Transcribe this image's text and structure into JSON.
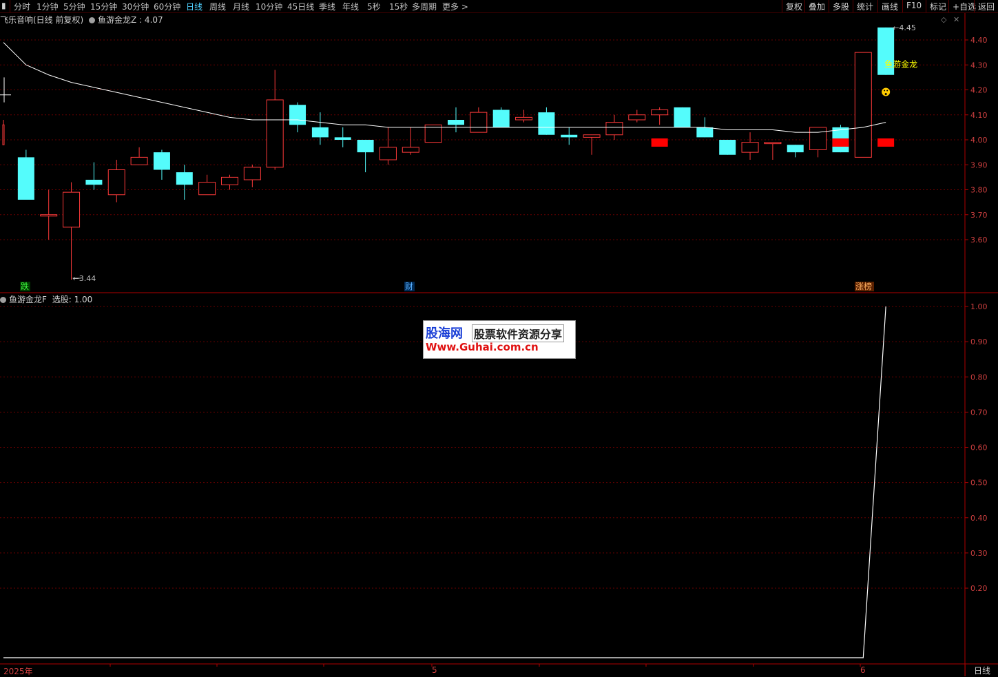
{
  "toolbar": {
    "periods": [
      "分时",
      "1分钟",
      "5分钟",
      "15分钟",
      "30分钟",
      "60分钟",
      "日线",
      "周线",
      "月线",
      "10分钟",
      "45日线",
      "季线",
      "年线",
      "5秒",
      "15秒",
      "多周期",
      "更多 >"
    ],
    "active_period": "日线",
    "right_buttons": [
      "复权",
      "叠加",
      "多股",
      "统计",
      "画线",
      "F10",
      "标记",
      "+自选",
      "返回"
    ]
  },
  "main_panel": {
    "stock_title": "飞乐音响(日线 前复权)",
    "indicator_name": "鱼游金龙Z",
    "indicator_value": ": 4.07",
    "y_ticks": [
      "4.40",
      "4.30",
      "4.20",
      "4.10",
      "4.00",
      "3.90",
      "3.80",
      "3.70",
      "3.60"
    ],
    "low_annotation": "3.44",
    "high_annotation": "4.45",
    "signal_text": "鱼游金龙",
    "event_labels": [
      "跌",
      "财",
      "涨榜"
    ]
  },
  "sub_panel": {
    "indicator_name": "鱼游金龙F",
    "indicator_value": "选股: 1.00",
    "y_ticks": [
      "1.00",
      "0.90",
      "0.80",
      "0.70",
      "0.60",
      "0.50",
      "0.40",
      "0.30",
      "0.20"
    ]
  },
  "x_axis": {
    "labels": [
      "2025年",
      "5",
      "6"
    ],
    "period": "日线"
  },
  "watermark": {
    "line1_brand": "股海网",
    "line1_text": "股票软件资源分享",
    "line2": "Www.Guhai.com.cn"
  },
  "colors": {
    "up": "#ff3a3a",
    "down": "#54fcfc",
    "ma": "#ffffff",
    "signal_bar": "#ff0000",
    "axis": "#b00000",
    "grid": "#6a0000"
  },
  "chart_data": [
    {
      "type": "candlestick",
      "ylim": [
        3.44,
        4.45
      ],
      "candles": [
        {
          "o": 3.98,
          "h": 4.08,
          "l": 4.02,
          "c": 4.06
        },
        {
          "o": 3.93,
          "h": 3.96,
          "l": 3.76,
          "c": 3.76
        },
        {
          "o": 3.7,
          "h": 3.8,
          "l": 3.6,
          "c": 3.7
        },
        {
          "o": 3.65,
          "h": 3.83,
          "l": 3.44,
          "c": 3.79
        },
        {
          "o": 3.84,
          "h": 3.91,
          "l": 3.8,
          "c": 3.82
        },
        {
          "o": 3.78,
          "h": 3.92,
          "l": 3.75,
          "c": 3.88
        },
        {
          "o": 3.9,
          "h": 3.97,
          "l": 3.9,
          "c": 3.93
        },
        {
          "o": 3.95,
          "h": 3.96,
          "l": 3.84,
          "c": 3.88
        },
        {
          "o": 3.87,
          "h": 3.9,
          "l": 3.76,
          "c": 3.82
        },
        {
          "o": 3.78,
          "h": 3.86,
          "l": 3.78,
          "c": 3.83
        },
        {
          "o": 3.82,
          "h": 3.86,
          "l": 3.8,
          "c": 3.85
        },
        {
          "o": 3.84,
          "h": 3.9,
          "l": 3.81,
          "c": 3.89
        },
        {
          "o": 3.89,
          "h": 4.28,
          "l": 3.88,
          "c": 4.16
        },
        {
          "o": 4.14,
          "h": 4.15,
          "l": 4.03,
          "c": 4.06
        },
        {
          "o": 4.05,
          "h": 4.11,
          "l": 3.98,
          "c": 4.01
        },
        {
          "o": 4.01,
          "h": 4.05,
          "l": 3.97,
          "c": 4.0
        },
        {
          "o": 4.0,
          "h": 4.0,
          "l": 3.87,
          "c": 3.95
        },
        {
          "o": 3.92,
          "h": 4.05,
          "l": 3.9,
          "c": 3.97
        },
        {
          "o": 3.95,
          "h": 4.05,
          "l": 3.94,
          "c": 3.97
        },
        {
          "o": 3.99,
          "h": 4.06,
          "l": 3.99,
          "c": 4.06
        },
        {
          "o": 4.08,
          "h": 4.13,
          "l": 4.03,
          "c": 4.06
        },
        {
          "o": 4.03,
          "h": 4.13,
          "l": 4.03,
          "c": 4.11
        },
        {
          "o": 4.12,
          "h": 4.13,
          "l": 4.05,
          "c": 4.05
        },
        {
          "o": 4.08,
          "h": 4.12,
          "l": 4.07,
          "c": 4.09
        },
        {
          "o": 4.11,
          "h": 4.13,
          "l": 4.02,
          "c": 4.02
        },
        {
          "o": 4.02,
          "h": 4.05,
          "l": 3.98,
          "c": 4.01
        },
        {
          "o": 4.01,
          "h": 4.02,
          "l": 3.94,
          "c": 4.02
        },
        {
          "o": 4.02,
          "h": 4.1,
          "l": 4.0,
          "c": 4.07
        },
        {
          "o": 4.08,
          "h": 4.12,
          "l": 4.07,
          "c": 4.1
        },
        {
          "o": 4.1,
          "h": 4.13,
          "l": 4.06,
          "c": 4.12
        },
        {
          "o": 4.13,
          "h": 4.13,
          "l": 4.05,
          "c": 4.05
        },
        {
          "o": 4.05,
          "h": 4.09,
          "l": 4.01,
          "c": 4.01
        },
        {
          "o": 4.0,
          "h": 4.0,
          "l": 3.94,
          "c": 3.94
        },
        {
          "o": 3.95,
          "h": 4.03,
          "l": 3.92,
          "c": 3.99
        },
        {
          "o": 3.99,
          "h": 3.99,
          "l": 3.92,
          "c": 3.99
        },
        {
          "o": 3.98,
          "h": 3.98,
          "l": 3.93,
          "c": 3.95
        },
        {
          "o": 3.96,
          "h": 4.05,
          "l": 3.93,
          "c": 4.05
        },
        {
          "o": 4.05,
          "h": 4.06,
          "l": 3.95,
          "c": 3.95
        },
        {
          "o": 3.93,
          "h": 4.35,
          "l": 3.93,
          "c": 4.35
        },
        {
          "o": 4.45,
          "h": 4.45,
          "l": 4.26,
          "c": 4.26
        }
      ],
      "ma_series": [
        4.39,
        4.3,
        4.26,
        4.23,
        4.21,
        4.19,
        4.17,
        4.15,
        4.13,
        4.11,
        4.09,
        4.08,
        4.08,
        4.08,
        4.07,
        4.06,
        4.06,
        4.05,
        4.05,
        4.05,
        4.05,
        4.05,
        4.05,
        4.05,
        4.05,
        4.05,
        4.05,
        4.05,
        4.05,
        4.05,
        4.05,
        4.05,
        4.04,
        4.04,
        4.04,
        4.03,
        4.03,
        4.04,
        4.05,
        4.07
      ],
      "signal_bars": [
        29,
        37,
        39
      ]
    },
    {
      "type": "line",
      "name": "选股",
      "values": [
        0,
        0,
        0,
        0,
        0,
        0,
        0,
        0,
        0,
        0,
        0,
        0,
        0,
        0,
        0,
        0,
        0,
        0,
        0,
        0,
        0,
        0,
        0,
        0,
        0,
        0,
        0,
        0,
        0,
        0,
        0,
        0,
        0,
        0,
        0,
        0,
        0,
        0,
        0,
        1.0
      ],
      "ylim": [
        0,
        1.0
      ]
    }
  ]
}
